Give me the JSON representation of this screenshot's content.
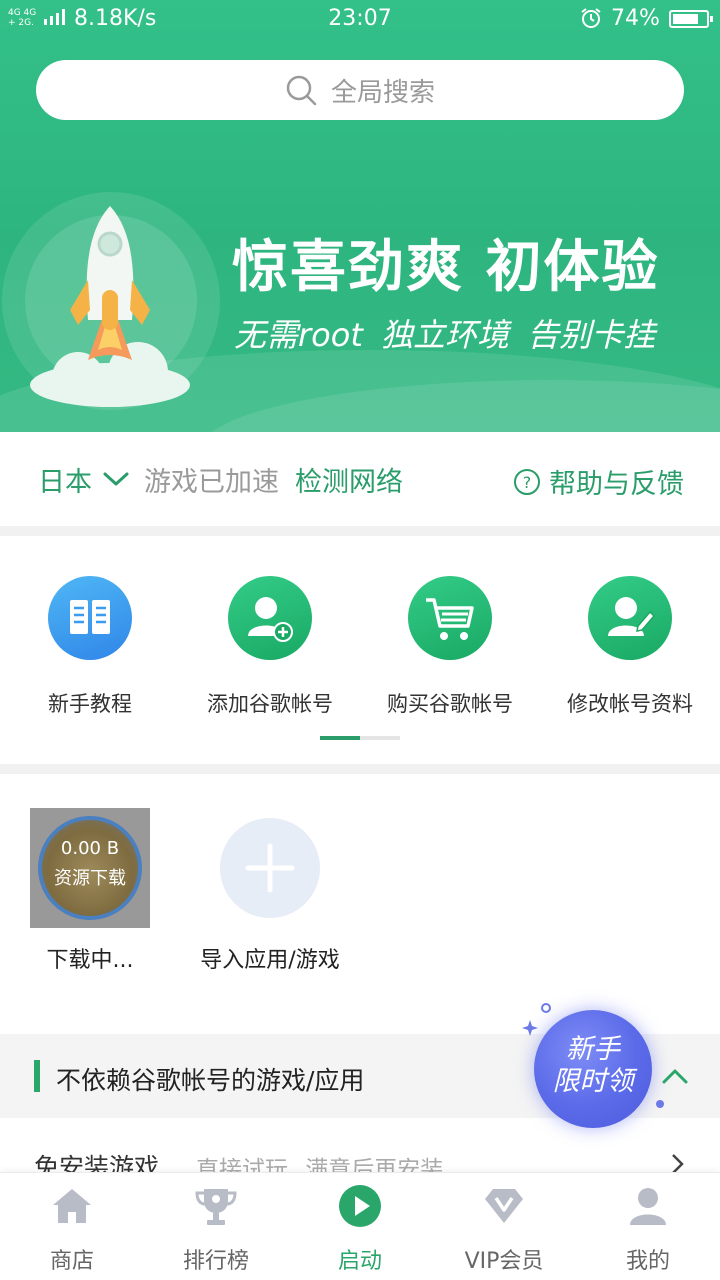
{
  "status_bar": {
    "network_line1": "4G 4G",
    "network_line2": "+ 2G.",
    "speed": "8.18K/s",
    "time": "23:07",
    "battery": "74%",
    "battery_level": 0.74
  },
  "search": {
    "placeholder": "全局搜索"
  },
  "hero": {
    "title": "惊喜劲爽  初体验",
    "subtitle": "无需root  独立环境  告别卡挂"
  },
  "region_bar": {
    "region": "日本",
    "status": "游戏已加速",
    "detect": "检测网络",
    "help": "帮助与反馈"
  },
  "features": [
    {
      "label": "新手教程",
      "icon": "book-icon",
      "color": "#3a9cf0"
    },
    {
      "label": "添加谷歌帐号",
      "icon": "add-account-icon",
      "color": "#22b874"
    },
    {
      "label": "购买谷歌帐号",
      "icon": "cart-icon",
      "color": "#22b874"
    },
    {
      "label": "修改帐号资料",
      "icon": "edit-profile-icon",
      "color": "#22b874"
    }
  ],
  "apps": {
    "downloading": {
      "size": "0.00 B",
      "status": "资源下载",
      "name": "下载中..."
    },
    "import": {
      "label": "导入应用/游戏"
    }
  },
  "section": {
    "title": "不依赖谷歌帐号的游戏/应用",
    "sub_title": "免安装游戏",
    "sub_desc": "直接试玩  满意后再安装"
  },
  "promo": {
    "line1": "新手",
    "line2": "限时领"
  },
  "bottom_nav": [
    {
      "label": "商店",
      "icon": "home-icon",
      "active": false
    },
    {
      "label": "排行榜",
      "icon": "trophy-icon",
      "active": false
    },
    {
      "label": "启动",
      "icon": "play-icon",
      "active": true
    },
    {
      "label": "VIP会员",
      "icon": "vip-diamond-icon",
      "active": false
    },
    {
      "label": "我的",
      "icon": "user-icon",
      "active": false
    }
  ],
  "colors": {
    "primary": "#2eb57f",
    "accent_text": "#2a9d6a",
    "promo": "#5a6ae8"
  }
}
